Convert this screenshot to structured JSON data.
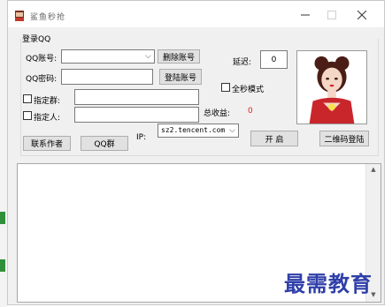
{
  "window": {
    "title": "鲨鱼秒抢",
    "minimize_icon": "minimize-icon",
    "maximize_icon": "maximize-icon",
    "close_icon": "close-icon"
  },
  "login_group": {
    "title": "登录QQ",
    "qq_account_label": "QQ账号:",
    "qq_account_value": "",
    "qq_password_label": "QQ密码:",
    "qq_password_value": "",
    "delete_account_label": "删除账号",
    "login_account_label": "登陆账号",
    "delay_label": "延迟:",
    "delay_value": "0",
    "full_second_label": "全秒模式",
    "designate_group_label": "指定群:",
    "designate_group_value": "",
    "designate_person_label": "指定人:",
    "designate_person_value": "",
    "total_profit_label": "总收益:",
    "total_profit_value": "0",
    "contact_author_label": "联系作者",
    "qq_group_label": "QQ群",
    "ip_label": "IP:",
    "ip_value": "sz2.tencent.com",
    "start_label": "开 启",
    "qr_login_label": "二维码登陆"
  },
  "log": {
    "text": ""
  },
  "watermark": "最需教育",
  "colors": {
    "profit": "#e02020",
    "watermark": "#2f3fa9"
  }
}
